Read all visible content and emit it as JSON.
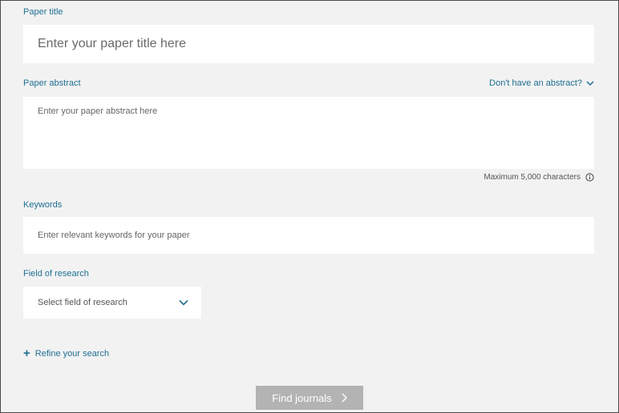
{
  "paper_title": {
    "label": "Paper title",
    "placeholder": "Enter your paper title here",
    "value": ""
  },
  "paper_abstract": {
    "label": "Paper abstract",
    "no_abstract_link": "Don't have an abstract?",
    "placeholder": "Enter your paper abstract here",
    "value": "",
    "max_chars_text": "Maximum 5,000 characters"
  },
  "keywords": {
    "label": "Keywords",
    "placeholder": "Enter relevant keywords for your paper",
    "value": ""
  },
  "field_of_research": {
    "label": "Field of research",
    "selected": "Select field of research"
  },
  "refine": {
    "label": "Refine your search"
  },
  "find_button": {
    "label": "Find journals"
  },
  "colors": {
    "accent": "#1f6f93",
    "background": "#f2f2f2",
    "button_disabled": "#b3b3b3"
  },
  "icons": {
    "no_abstract_link": "chevron-down-icon",
    "max_chars": "info-icon",
    "select": "chevron-down-icon",
    "refine": "plus-icon",
    "find_button": "chevron-right-icon"
  }
}
